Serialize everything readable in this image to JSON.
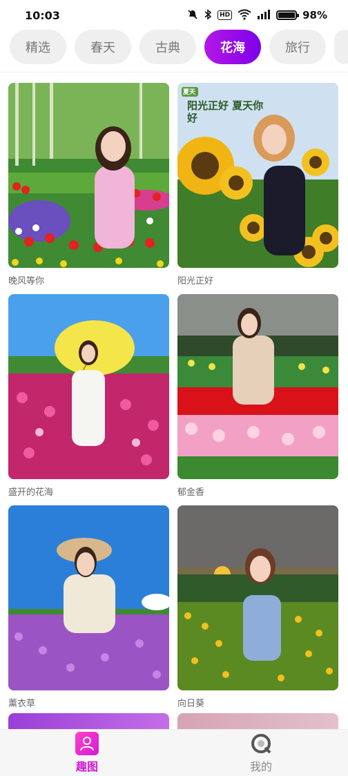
{
  "status_bar": {
    "time": "10:03",
    "icons": [
      "mute-icon",
      "bluetooth-icon",
      "hd-icon",
      "wifi-icon",
      "signal-icon",
      "battery-icon"
    ],
    "hd_text": "HD",
    "battery_percent": "98%",
    "battery_level": 0.98
  },
  "tabs": [
    {
      "label": "精选",
      "active": false
    },
    {
      "label": "春天",
      "active": false
    },
    {
      "label": "古典",
      "active": false
    },
    {
      "label": "花海",
      "active": true
    },
    {
      "label": "旅行",
      "active": false
    }
  ],
  "cards": [
    {
      "label": "晚风等你"
    },
    {
      "label": "阳光正好",
      "overlay_text": "阳光正好 夏天你好",
      "badge": "夏天"
    },
    {
      "label": "盛开的花海"
    },
    {
      "label": "郁金香"
    },
    {
      "label": "薰衣草"
    },
    {
      "label": "向日葵"
    }
  ],
  "bottom_nav": [
    {
      "label": "趣图",
      "icon": "person-icon",
      "active": true
    },
    {
      "label": "我的",
      "icon": "profile-q-icon",
      "active": false
    }
  ],
  "colors": {
    "accent": "#b418e6",
    "nav_active": "#d11ad6"
  }
}
